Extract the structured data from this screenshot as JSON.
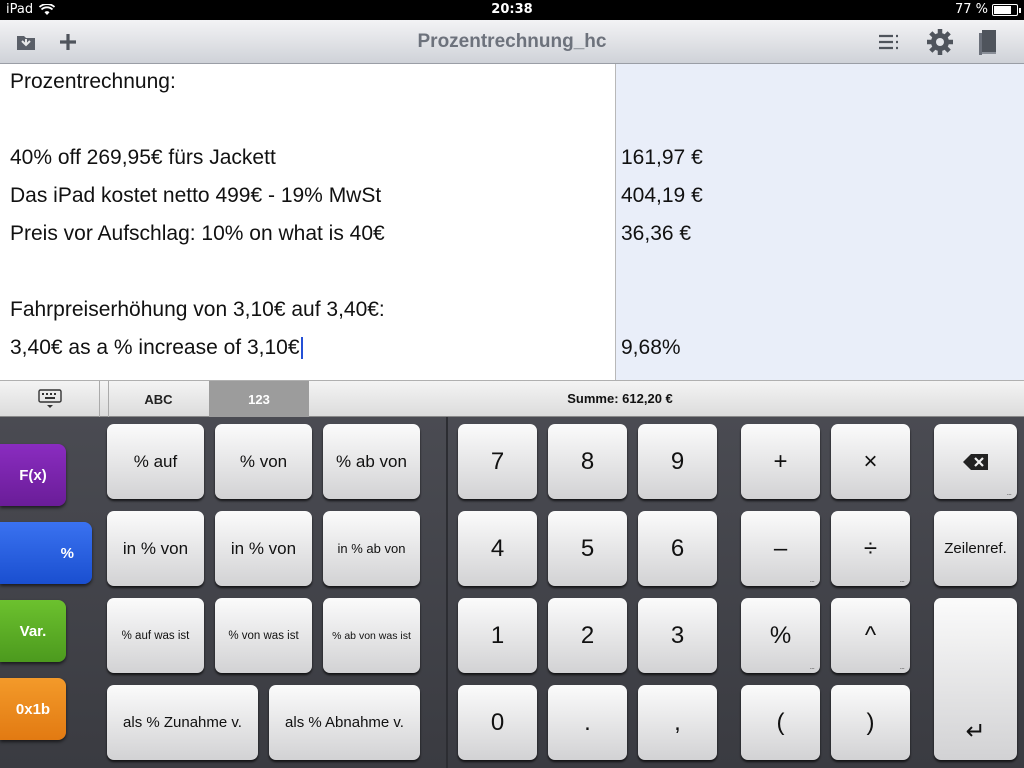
{
  "status": {
    "carrier": "iPad",
    "time": "20:38",
    "battery": "77 %",
    "battery_level": 0.77
  },
  "nav": {
    "title": "Prozentrechnung_hc"
  },
  "doc": {
    "lines": [
      "Prozentrechnung:",
      "",
      "40% off 269,95€ fürs Jackett",
      "Das iPad kostet netto 499€ - 19% MwSt",
      "Preis vor Aufschlag: 10% on what is 40€",
      "",
      "Fahrpreiserhöhung von 3,10€ auf 3,40€:",
      "3,40€ as a % increase of 3,10€"
    ],
    "results": [
      "",
      "",
      "161,97 €",
      "404,19 €",
      "36,36 €",
      "",
      "",
      "9,68%"
    ]
  },
  "tabs": {
    "abc": "ABC",
    "n123": "123"
  },
  "summe": {
    "label": "Summe:",
    "value": "612,20 €"
  },
  "side": {
    "fx": "F(x)",
    "pct": "%",
    "var": "Var.",
    "hex": "0x1b"
  },
  "pct_keys": {
    "auf": "% auf",
    "von": "% von",
    "abvon": "% ab von",
    "in_von1": "in % von",
    "in_von2": "in % von",
    "in_abvon": "in % ab von",
    "auf_was": "% auf was ist",
    "von_was": "% von was ist",
    "abvon_was": "% ab von was ist",
    "zunahme": "als % Zunahme v.",
    "abnahme": "als % Abnahme v."
  },
  "num_keys": {
    "k7": "7",
    "k8": "8",
    "k9": "9",
    "k4": "4",
    "k5": "5",
    "k6": "6",
    "k1": "1",
    "k2": "2",
    "k3": "3",
    "k0": "0",
    "dot": ".",
    "comma": ","
  },
  "op_keys": {
    "plus": "+",
    "times": "×",
    "minus": "–",
    "div": "÷",
    "pct": "%",
    "pow": "^",
    "lparen": "(",
    "rparen": ")",
    "zeilenref": "Zeilenref.",
    "enter": "↵"
  },
  "colors": {
    "fx": "#8a2cc0",
    "pct": "#1a4fd0",
    "var": "#4c9a1e",
    "hex": "#e27a12",
    "results_bg": "#e9eef9"
  }
}
